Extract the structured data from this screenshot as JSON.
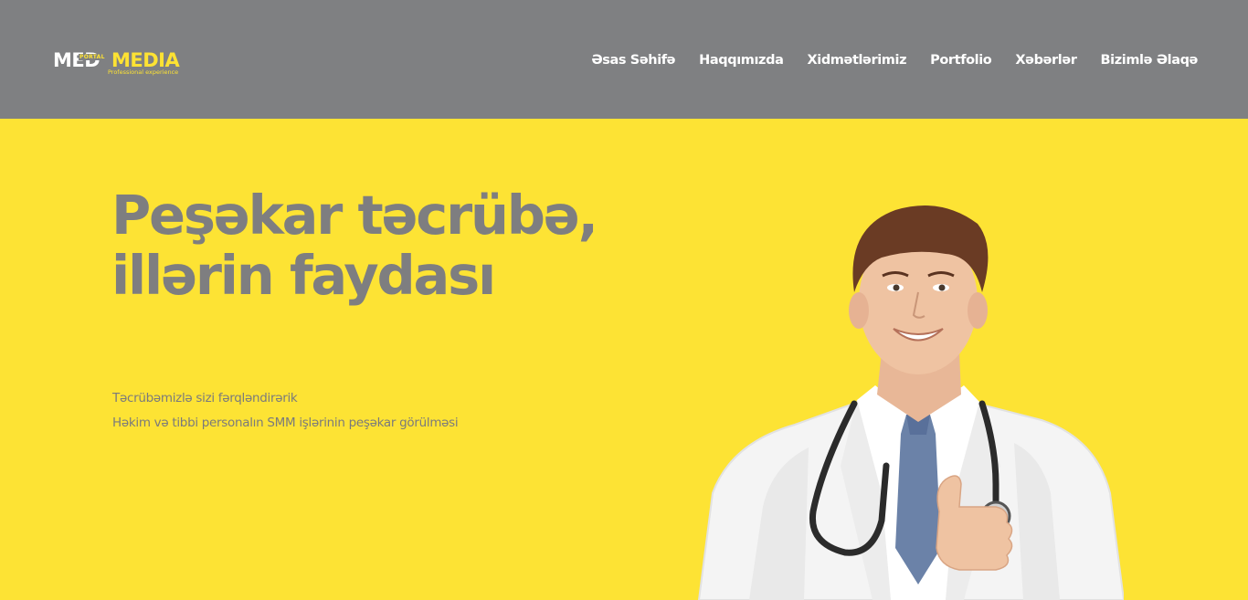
{
  "brand": {
    "logo_word_1": "MED",
    "logo_word_2": "MEDIA",
    "logo_badge": "PORTAL",
    "logo_tagline": "Professional experience",
    "colors": {
      "header_bg": "#7f8082",
      "accent_yellow": "#fde334",
      "heading_gray": "#7e7e80"
    }
  },
  "nav": {
    "items": [
      {
        "label": "Əsas Səhifə"
      },
      {
        "label": "Haqqımızda"
      },
      {
        "label": "Xidmətlərimiz"
      },
      {
        "label": "Portfolio"
      },
      {
        "label": "Xəbərlər"
      },
      {
        "label": "Bizimlə Əlaqə"
      }
    ]
  },
  "hero": {
    "headline_line_1": "Peşəkar təcrübə,",
    "headline_line_2": "illərin faydası",
    "subtitle_line_1": "Təcrübəmizlə sizi fərqləndirərik",
    "subtitle_line_2": "Həkim və tibbi personalın SMM işlərinin peşəkar görülməsi",
    "image": "smiling-doctor-thumbs-up"
  }
}
